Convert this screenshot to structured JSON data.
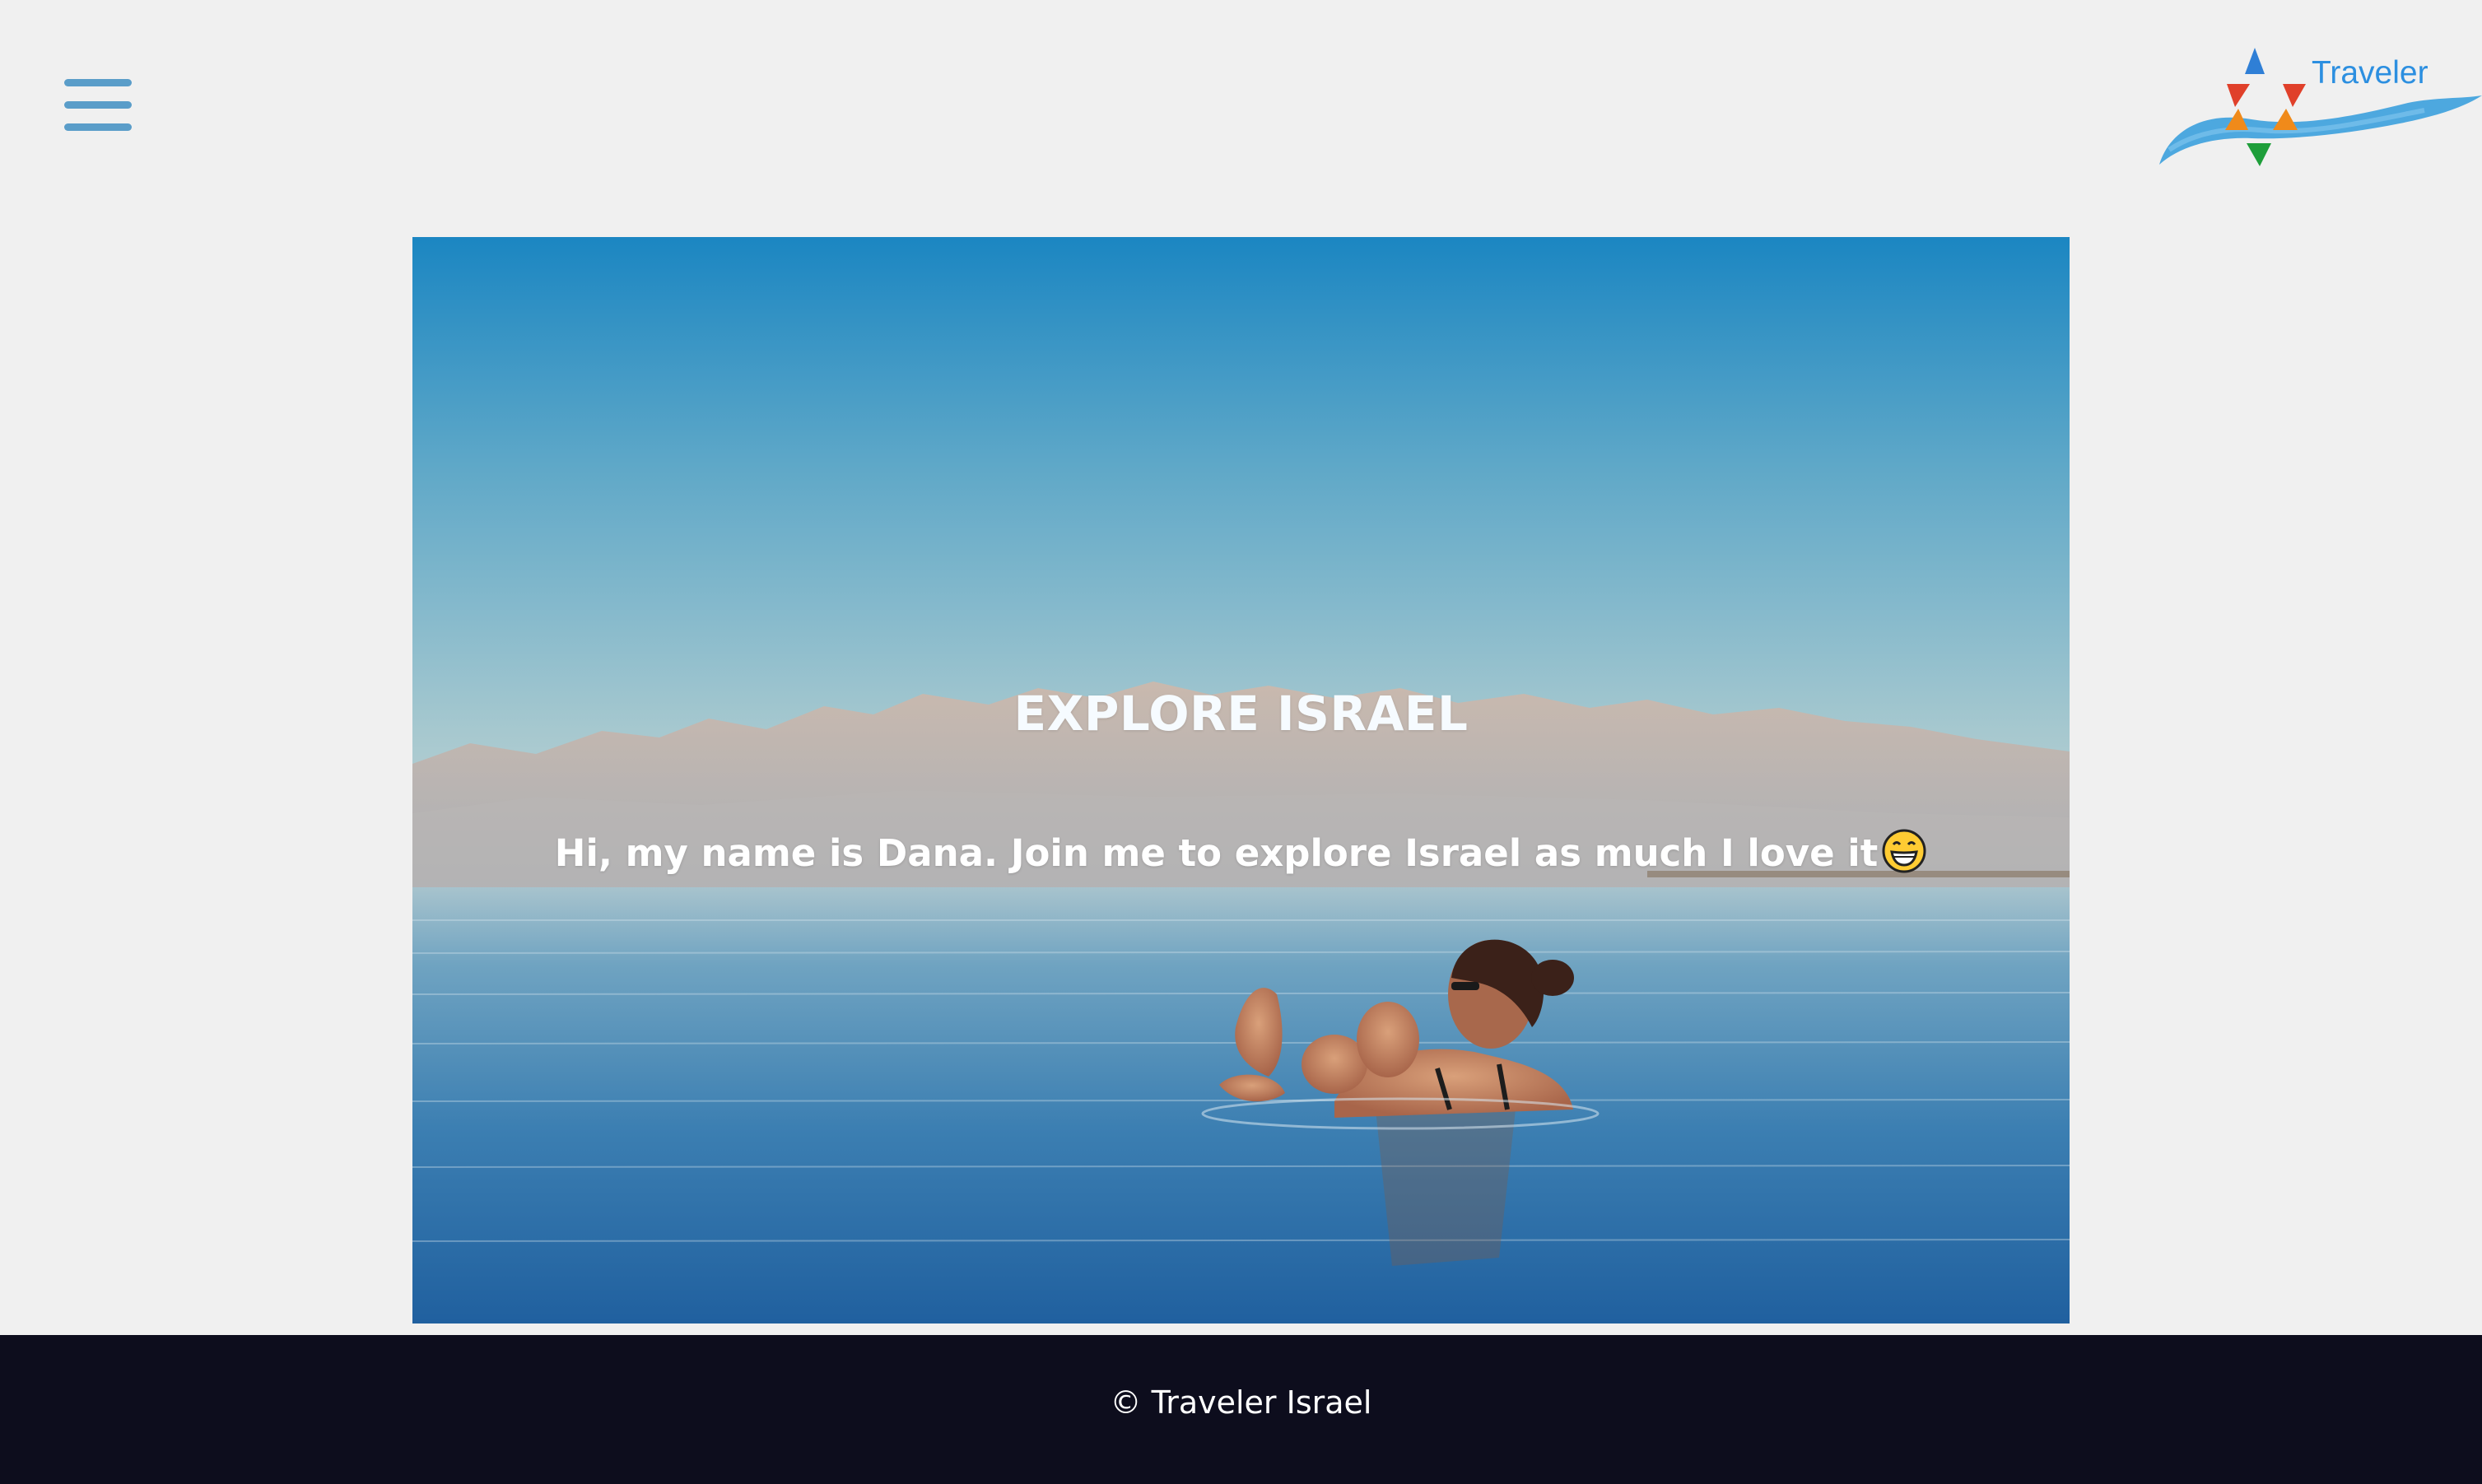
{
  "header": {
    "menu_icon": "hamburger-menu-icon",
    "logo": {
      "text": "Traveler",
      "icon": "star-of-david-wave-logo",
      "text_color": "#2c8fe0"
    },
    "accent_color": "#5a9dc9"
  },
  "hero": {
    "title": "EXPLORE ISRAEL",
    "subtitle": "Hi, my name is Dana. Join me to explore Israel as much I love it",
    "emoji": "grinning-face-emoji",
    "image": "woman-floating-in-dead-sea-photo"
  },
  "footer": {
    "text": "© Traveler Israel",
    "background": "#0d0d1d"
  }
}
